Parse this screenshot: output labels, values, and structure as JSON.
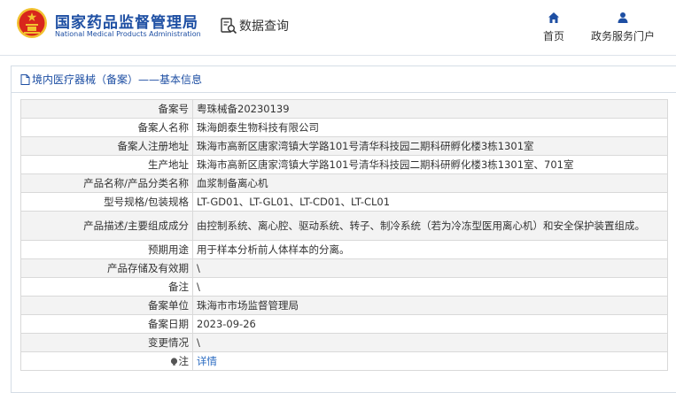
{
  "header": {
    "logo_cn": "国家药品监督管理局",
    "logo_en": "National Medical Products Administration",
    "query_label": "数据查询",
    "nav": [
      {
        "label": "首页",
        "icon": "home-icon"
      },
      {
        "label": "政务服务门户",
        "icon": "user-icon"
      }
    ]
  },
  "panel": {
    "title": "境内医疗器械（备案）——基本信息"
  },
  "rows": [
    {
      "label": "备案号",
      "value": "粤珠械备20230139"
    },
    {
      "label": "备案人名称",
      "value": "珠海朗泰生物科技有限公司"
    },
    {
      "label": "备案人注册地址",
      "value": "珠海市高新区唐家湾镇大学路101号清华科技园二期科研孵化楼3栋1301室"
    },
    {
      "label": "生产地址",
      "value": "珠海市高新区唐家湾镇大学路101号清华科技园二期科研孵化楼3栋1301室、701室"
    },
    {
      "label": "产品名称/产品分类名称",
      "value": "血浆制备离心机"
    },
    {
      "label": "型号规格/包装规格",
      "value": "LT-GD01、LT-GL01、LT-CD01、LT-CL01"
    },
    {
      "label": "产品描述/主要组成成分",
      "value": "由控制系统、离心腔、驱动系统、转子、制冷系统（若为冷冻型医用离心机）和安全保护装置组成。"
    },
    {
      "label": "预期用途",
      "value": "用于样本分析前人体样本的分离。"
    },
    {
      "label": "产品存储及有效期",
      "value": "\\"
    },
    {
      "label": "备注",
      "value": "\\"
    },
    {
      "label": "备案单位",
      "value": "珠海市市场监督管理局"
    },
    {
      "label": "备案日期",
      "value": "2023-09-26"
    },
    {
      "label": "变更情况",
      "value": "\\"
    },
    {
      "label": "注",
      "value": "详情"
    }
  ],
  "colors": {
    "brand_blue": "#1e4fa3",
    "link_blue": "#2a6bc1",
    "row_stripe": "#f3f3f3"
  }
}
